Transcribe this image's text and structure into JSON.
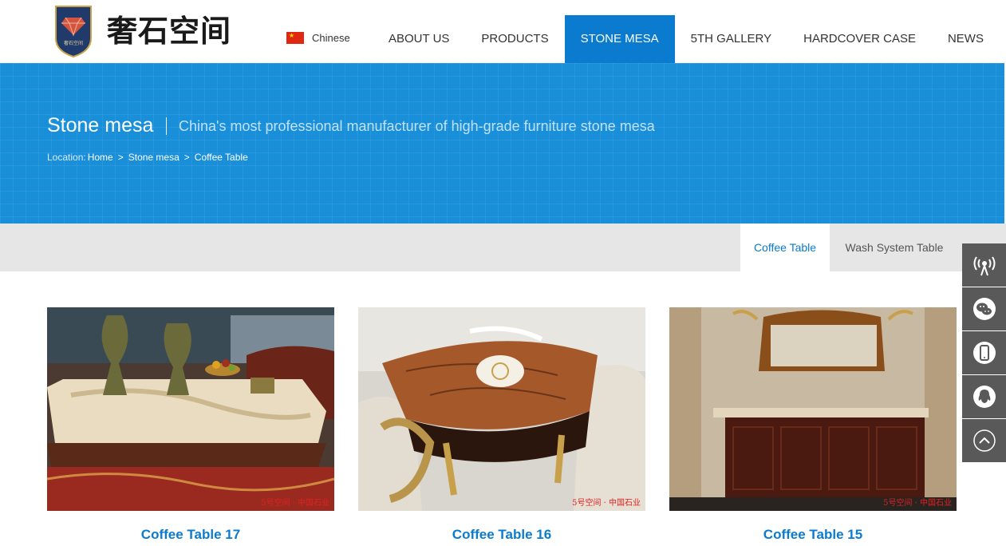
{
  "header": {
    "logo_text": "奢石空间",
    "logo_badge_text": "奢石空间",
    "language": {
      "label": "Chinese",
      "icon": "china-flag-icon"
    },
    "nav": [
      {
        "label": "ABOUT US",
        "active": false
      },
      {
        "label": "PRODUCTS",
        "active": false
      },
      {
        "label": "STONE MESA",
        "active": true
      },
      {
        "label": "5TH GALLERY",
        "active": false
      },
      {
        "label": "HARDCOVER CASE",
        "active": false
      },
      {
        "label": "NEWS",
        "active": false
      }
    ]
  },
  "banner": {
    "title": "Stone mesa",
    "subtitle": "China's most professional manufacturer of high-grade furniture stone mesa",
    "breadcrumb": {
      "prefix": "Location:",
      "items": [
        "Home",
        "Stone mesa",
        "Coffee Table"
      ],
      "separator": ">"
    }
  },
  "subnav": {
    "tabs": [
      {
        "label": "Coffee Table",
        "active": true
      },
      {
        "label": "Wash System Table",
        "active": false
      }
    ]
  },
  "products": [
    {
      "name": "Coffee Table 17",
      "watermark": "5号空间 · 中国石业"
    },
    {
      "name": "Coffee Table 16",
      "watermark": "5号空间 · 中国石业"
    },
    {
      "name": "Coffee Table 15",
      "watermark": "5号空间 · 中国石业"
    }
  ],
  "sidebar": {
    "buttons": [
      "broadcast-icon",
      "wechat-icon",
      "mobile-phone-icon",
      "qq-icon",
      "back-to-top-icon"
    ]
  },
  "colors": {
    "accent": "#0a7bcf",
    "banner": "#1a8fd9",
    "subbar": "#e6e6e6",
    "sidebar": "#595959"
  }
}
